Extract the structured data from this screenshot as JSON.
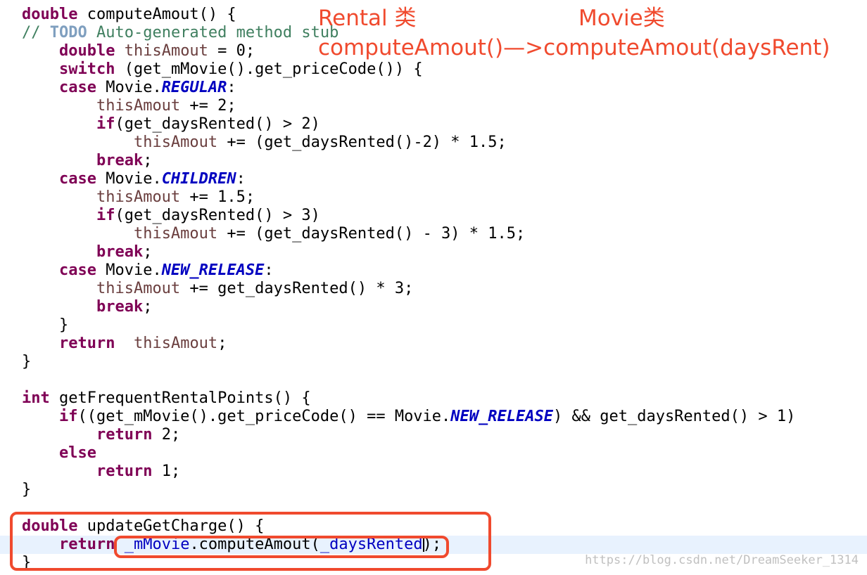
{
  "annotations": {
    "rental_class": "Rental 类",
    "movie_class": "Movie类",
    "refactor_note": "computeAmout()—>computeAmout(daysRent)"
  },
  "code": {
    "l1": {
      "kw": "double",
      "rest": " computeAmout() {"
    },
    "l2": {
      "comment_a": "// ",
      "todo": "TODO",
      "comment_b": " Auto-generated method stub"
    },
    "l3": {
      "indent": "    ",
      "kw": "double",
      "sp": " ",
      "var": "thisAmout",
      "rest": " = 0;"
    },
    "l4": {
      "indent": "    ",
      "kw": "switch",
      "rest": " (get_mMovie().get_priceCode()) {"
    },
    "l5": {
      "indent": "    ",
      "kw": "case",
      "a": " Movie.",
      "const": "REGULAR",
      "b": ":"
    },
    "l6": {
      "indent": "        ",
      "var": "thisAmout",
      "rest": " += 2;"
    },
    "l7": {
      "indent": "        ",
      "kw": "if",
      "rest": "(get_daysRented() > 2)"
    },
    "l8": {
      "indent": "            ",
      "var": "thisAmout",
      "rest": " += (get_daysRented()-2) * 1.5;"
    },
    "l9": {
      "indent": "        ",
      "kw": "break",
      "rest": ";"
    },
    "l10": {
      "indent": "    ",
      "kw": "case",
      "a": " Movie.",
      "const": "CHILDREN",
      "b": ":"
    },
    "l11": {
      "indent": "        ",
      "var": "thisAmout",
      "rest": " += 1.5;"
    },
    "l12": {
      "indent": "        ",
      "kw": "if",
      "rest": "(get_daysRented() > 3)"
    },
    "l13": {
      "indent": "            ",
      "var": "thisAmout",
      "rest": " += (get_daysRented() - 3) * 1.5;"
    },
    "l14": {
      "indent": "        ",
      "kw": "break",
      "rest": ";"
    },
    "l15": {
      "indent": "    ",
      "kw": "case",
      "a": " Movie.",
      "const": "NEW_RELEASE",
      "b": ":"
    },
    "l16": {
      "indent": "        ",
      "var": "thisAmout",
      "a": " += get_daysRented() * 3;"
    },
    "l17": {
      "indent": "        ",
      "kw": "break",
      "rest": ";"
    },
    "l18": {
      "text": "    }"
    },
    "l19": {
      "indent": "    ",
      "kw": "return",
      "sp": "  ",
      "var": "thisAmout",
      "rest": ";"
    },
    "l20": {
      "text": "}"
    },
    "l22": {
      "kw": "int",
      "rest": " getFrequentRentalPoints() {"
    },
    "l23": {
      "indent": "    ",
      "kw": "if",
      "a": "((get_mMovie().get_priceCode() == Movie.",
      "const": "NEW_RELEASE",
      "b": ") && get_daysRented() > 1)"
    },
    "l24": {
      "indent": "        ",
      "kw": "return",
      "rest": " 2;"
    },
    "l25": {
      "indent": "    ",
      "kw": "else"
    },
    "l26": {
      "indent": "        ",
      "kw": "return",
      "rest": " 1;"
    },
    "l27": {
      "text": "}"
    },
    "l29": {
      "kw": "double",
      "rest": " updateGetCharge() {"
    },
    "l30": {
      "indent": "    ",
      "kw": "return",
      "sp": " ",
      "field1": "_mMovie",
      "a": ".computeAmout(",
      "field2": "_daysRented",
      "b": ");"
    },
    "l31": {
      "text": "}"
    }
  },
  "watermark": "https://blog.csdn.net/DreamSeeker_1314",
  "colors": {
    "keyword": "#7f0055",
    "comment": "#3f7f5f",
    "todo": "#7f9fbf",
    "constant": "#0000c0",
    "local_variable": "#6a3e3e",
    "field": "#0000c0",
    "annotation": "#f04a2e",
    "current_line": "#e8f2fe"
  }
}
